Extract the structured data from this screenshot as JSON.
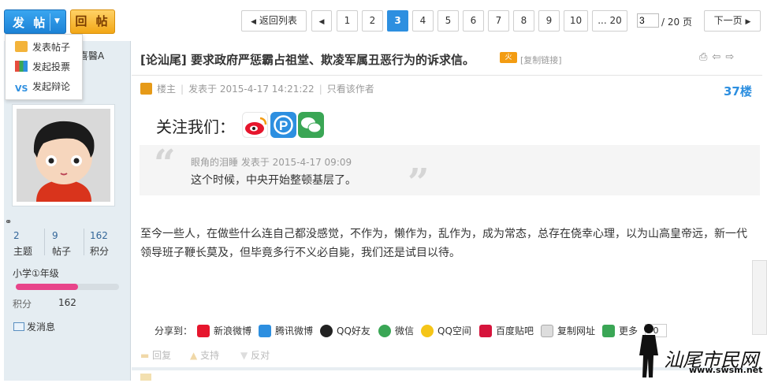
{
  "toolbar": {
    "post_button": "发 帖",
    "reply_button": "回 帖"
  },
  "dropdown": {
    "items": [
      "发表帖子",
      "发起投票",
      "发起辩论"
    ]
  },
  "pagination": {
    "back_label": "返回列表",
    "pages": [
      "1",
      "2",
      "3",
      "4",
      "5",
      "6",
      "7",
      "8",
      "9",
      "10",
      "... 20"
    ],
    "current_page": "3",
    "total_label": "/ 20 页",
    "next_label": "下一页"
  },
  "author": {
    "name": "喜醫A",
    "stats": [
      {
        "value": "2",
        "label": "主题"
      },
      {
        "value": "9",
        "label": "帖子"
      },
      {
        "value": "162",
        "label": "积分"
      }
    ],
    "level": "小学①年级",
    "level_progress": 0.6,
    "jifen_label": "积分",
    "jifen_value": "162",
    "message_label": "发消息"
  },
  "post": {
    "category": "[论汕尾]",
    "title": "要求政府严惩霸占祖堂、欺凌军属丑恶行为的诉求信。",
    "tag": "火",
    "copy_link": "[复制链接]",
    "louzhu": "楼主",
    "posted_at": "发表于 2015-4-17 14:21:22",
    "only_author": "只看该作者",
    "floor": "37楼",
    "follow_label": "关注我们：",
    "quote_meta": "眼角的泪睡 发表于 2015-4-17 09:09",
    "quote_text": "这个时候，中央开始整顿基层了。",
    "body": "至今一些人，在做些什么连自己都没感觉，不作为，懒作为，乱作为，成为常态，总存在侥幸心理，以为山高皇帝远，新一代领导班子鞭长莫及，但毕竟多行不义必自毙，我们还是试目以待。"
  },
  "share": {
    "label": "分享到：",
    "items": [
      "新浪微博",
      "腾讯微博",
      "QQ好友",
      "微信",
      "QQ空间",
      "百度贴吧",
      "复制网址",
      "更多"
    ],
    "count": "0"
  },
  "actions": {
    "reply": "回复",
    "support": "支持",
    "oppose": "反对"
  },
  "watermark": {
    "site_name": "汕尾市民网",
    "url": "www.swsm.net"
  },
  "colors": {
    "accent": "#2d8fe0",
    "reply_btn": "#f2a716",
    "sidebar_bg": "#e5edf2",
    "level_bar": "#e8448a"
  }
}
